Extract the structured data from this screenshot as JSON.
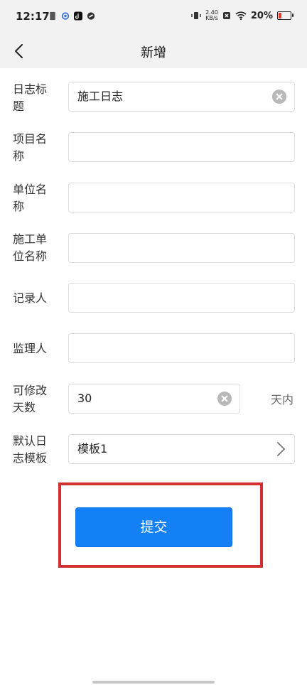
{
  "status_bar": {
    "time": "12:17",
    "net_speed_value": "2.40",
    "net_speed_unit": "KB/s",
    "battery_percent": "20%"
  },
  "nav": {
    "title": "新增"
  },
  "form": {
    "log_title": {
      "label": "日志标题",
      "value": "施工日志"
    },
    "project_name": {
      "label": "项目名称",
      "value": ""
    },
    "unit_name": {
      "label": "单位名称",
      "value": ""
    },
    "construction_unit_name": {
      "label": "施工单位名称",
      "value": ""
    },
    "recorder": {
      "label": "记录人",
      "value": ""
    },
    "supervisor": {
      "label": "监理人",
      "value": ""
    },
    "editable_days": {
      "label": "可修改天数",
      "value": "30",
      "suffix": "天内"
    },
    "default_template": {
      "label": "默认日志模板",
      "value": "模板1"
    }
  },
  "submit": {
    "label": "提交"
  },
  "colors": {
    "primary": "#1380f5",
    "highlight": "#d32f2f",
    "battery_low": "#e53935"
  }
}
